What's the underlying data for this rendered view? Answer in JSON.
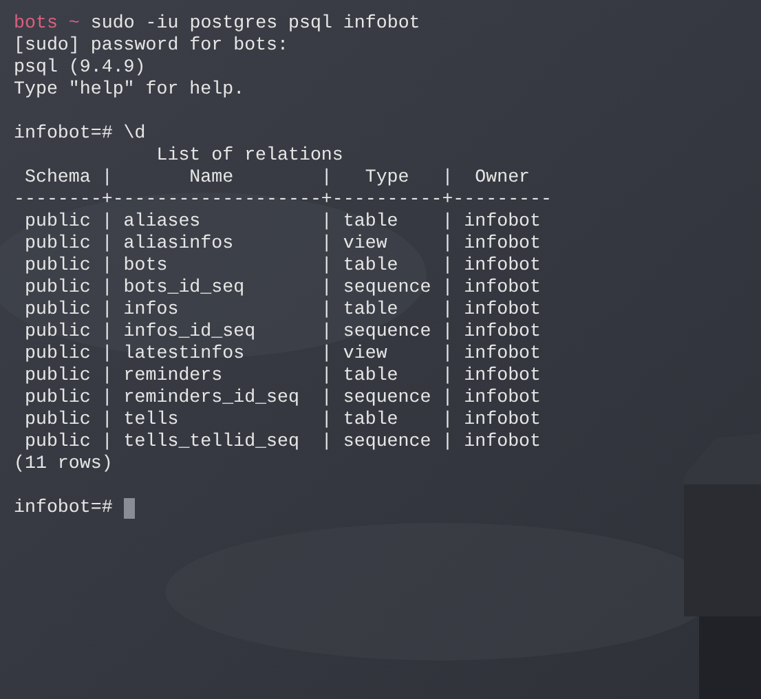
{
  "terminal": {
    "lines": [
      {
        "kind": "prompt",
        "user": "bots",
        "path": "~",
        "text": "sudo -iu postgres psql infobot"
      },
      {
        "kind": "output",
        "text": "[sudo] password for bots:"
      },
      {
        "kind": "output",
        "text": "psql (9.4.9)"
      },
      {
        "kind": "output",
        "text": "Type \"help\" for help."
      },
      {
        "kind": "blank"
      },
      {
        "kind": "output",
        "text": "infobot=# \\d"
      },
      {
        "kind": "output",
        "text": "             List of relations"
      },
      {
        "kind": "output",
        "text": " Schema |       Name        |   Type   |  Owner"
      },
      {
        "kind": "output",
        "text": "--------+-------------------+----------+---------"
      },
      {
        "kind": "output",
        "text": " public | aliases           | table    | infobot"
      },
      {
        "kind": "output",
        "text": " public | aliasinfos        | view     | infobot"
      },
      {
        "kind": "output",
        "text": " public | bots              | table    | infobot"
      },
      {
        "kind": "output",
        "text": " public | bots_id_seq       | sequence | infobot"
      },
      {
        "kind": "output",
        "text": " public | infos             | table    | infobot"
      },
      {
        "kind": "output",
        "text": " public | infos_id_seq      | sequence | infobot"
      },
      {
        "kind": "output",
        "text": " public | latestinfos       | view     | infobot"
      },
      {
        "kind": "output",
        "text": " public | reminders         | table    | infobot"
      },
      {
        "kind": "output",
        "text": " public | reminders_id_seq  | sequence | infobot"
      },
      {
        "kind": "output",
        "text": " public | tells             | table    | infobot"
      },
      {
        "kind": "output",
        "text": " public | tells_tellid_seq  | sequence | infobot"
      },
      {
        "kind": "output",
        "text": "(11 rows)"
      },
      {
        "kind": "blank"
      },
      {
        "kind": "input",
        "text": "infobot=# ",
        "cursor": true
      }
    ]
  }
}
